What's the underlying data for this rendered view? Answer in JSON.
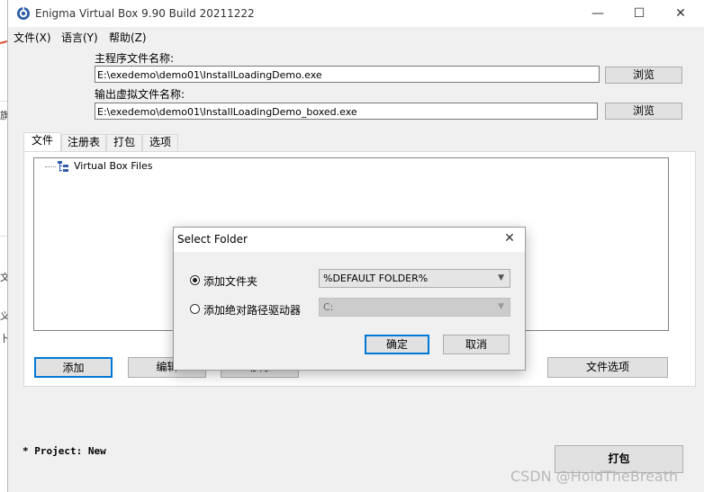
{
  "window": {
    "title": "Enigma Virtual Box 9.90 Build 20211222",
    "minimize": "—",
    "maximize": "☐",
    "close": "✕"
  },
  "menu": [
    {
      "label": "文件(X)"
    },
    {
      "label": "语言(Y)"
    },
    {
      "label": "帮助(Z)"
    }
  ],
  "main_file": {
    "label": "主程序文件名称:",
    "value": "E:\\exedemo\\demo01\\InstallLoadingDemo.exe",
    "browse": "浏览"
  },
  "output_file": {
    "label": "输出虚拟文件名称:",
    "value": "E:\\exedemo\\demo01\\InstallLoadingDemo_boxed.exe",
    "browse": "浏览"
  },
  "tabs": [
    {
      "label": "文件",
      "active": true
    },
    {
      "label": "注册表",
      "active": false
    },
    {
      "label": "打包",
      "active": false
    },
    {
      "label": "选项",
      "active": false
    }
  ],
  "tree": {
    "root": "Virtual Box Files",
    "icon": "tree-folder-icon"
  },
  "actions": {
    "add": "添加",
    "edit": "编辑",
    "remove": "移除",
    "file_options": "文件选项"
  },
  "project": "* Project: New",
  "pack_button": "打包",
  "dialog": {
    "title": "Select Folder",
    "close": "✕",
    "option_folder": "添加文件夹",
    "option_drive": "添加绝对路径驱动器",
    "folder_value": "%DEFAULT FOLDER%",
    "drive_value": "C:",
    "ok": "确定",
    "cancel": "取消"
  },
  "watermark": "CSDN @HoldTheBreath",
  "background_glyphs": [
    "旗",
    "文",
    "义",
    "卜"
  ],
  "colors": {
    "accent_border": "#0078d7",
    "window_bg": "#f0f0f0"
  }
}
